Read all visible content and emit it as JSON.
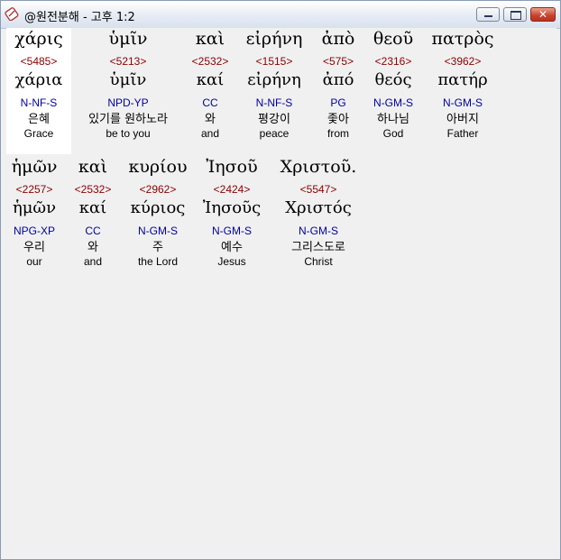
{
  "window": {
    "title": "@원전분해 - 고후 1:2",
    "buttons": {
      "minimize": "minimize",
      "maximize": "maximize",
      "close": "✕"
    }
  },
  "lines": [
    {
      "words": [
        {
          "greek": "χάρις",
          "strong": "<5485>",
          "lemma": "χάρια",
          "parse": "N-NF-S",
          "korean": "은혜",
          "english": "Grace"
        },
        {
          "greek": "ὑμῖν",
          "strong": "<5213>",
          "lemma": "ὑμῖν",
          "parse": "NPD-YP",
          "korean": "있기를 원하노라",
          "english": "be to you"
        },
        {
          "greek": "καὶ",
          "strong": "<2532>",
          "lemma": "καί",
          "parse": "CC",
          "korean": "와",
          "english": "and"
        },
        {
          "greek": "εἰρήνη",
          "strong": "<1515>",
          "lemma": "εἰρήνη",
          "parse": "N-NF-S",
          "korean": "평강이",
          "english": "peace"
        },
        {
          "greek": "ἀπὸ",
          "strong": "<575>",
          "lemma": "ἀπό",
          "parse": "PG",
          "korean": "좇아",
          "english": "from"
        },
        {
          "greek": "θεοῦ",
          "strong": "<2316>",
          "lemma": "θεός",
          "parse": "N-GM-S",
          "korean": "하나님",
          "english": "God"
        },
        {
          "greek": "πατρὸς",
          "strong": "<3962>",
          "lemma": "πατήρ",
          "parse": "N-GM-S",
          "korean": "아버지",
          "english": "Father"
        }
      ]
    },
    {
      "words": [
        {
          "greek": "ἡμῶν",
          "strong": "<2257>",
          "lemma": "ἡμῶν",
          "parse": "NPG-XP",
          "korean": "우리",
          "english": "our"
        },
        {
          "greek": "καὶ",
          "strong": "<2532>",
          "lemma": "καί",
          "parse": "CC",
          "korean": "와",
          "english": "and"
        },
        {
          "greek": "κυρίου",
          "strong": "<2962>",
          "lemma": "κύριος",
          "parse": "N-GM-S",
          "korean": "주",
          "english": "the Lord"
        },
        {
          "greek": "Ἰησοῦ",
          "strong": "<2424>",
          "lemma": "Ἰησοῦς",
          "parse": "N-GM-S",
          "korean": "예수",
          "english": "Jesus"
        },
        {
          "greek": "Χριστοῦ.",
          "strong": "<5547>",
          "lemma": "Χριστός",
          "parse": "N-GM-S",
          "korean": "그리스도로",
          "english": "Christ"
        }
      ]
    }
  ],
  "colors": {
    "strong": "#8b0000",
    "parse": "#0000a0",
    "background": "#f0f0f0",
    "selected": "#ffffff"
  }
}
